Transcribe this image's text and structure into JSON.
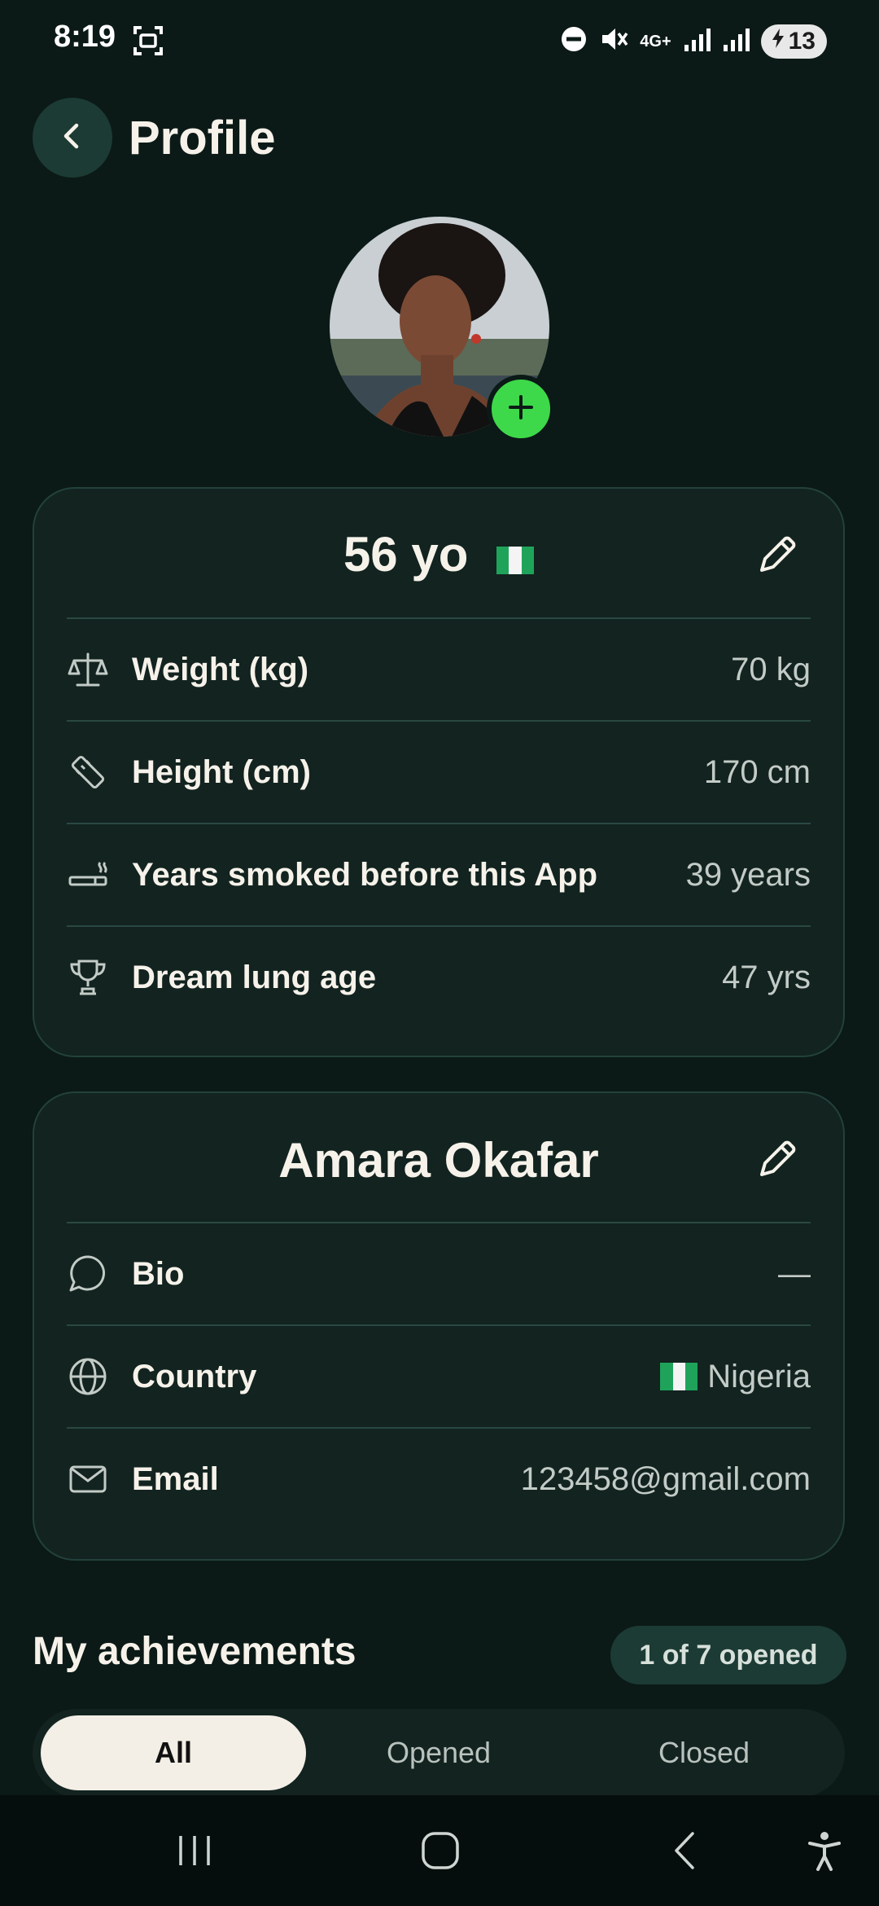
{
  "status_bar": {
    "time": "8:19",
    "network": "4G+",
    "battery": "13"
  },
  "header": {
    "title": "Profile"
  },
  "stats_card": {
    "title": "56 yo",
    "rows": [
      {
        "label": "Weight (kg)",
        "value": "70 kg",
        "icon": "scale-icon"
      },
      {
        "label": "Height (cm)",
        "value": "170 cm",
        "icon": "ruler-icon"
      },
      {
        "label": "Years smoked before this App",
        "value": "39 years",
        "icon": "cigarette-icon"
      },
      {
        "label": "Dream lung age",
        "value": "47 yrs",
        "icon": "trophy-icon"
      }
    ]
  },
  "info_card": {
    "name": "Amara Okafar",
    "rows": [
      {
        "label": "Bio",
        "value": "—",
        "icon": "chat-bubble-icon"
      },
      {
        "label": "Country",
        "value": "Nigeria",
        "icon": "globe-icon"
      },
      {
        "label": "Email",
        "value": "123458@gmail.com",
        "icon": "mail-icon"
      }
    ]
  },
  "achievements": {
    "title": "My achievements",
    "badge": "1 of 7 opened",
    "tabs": [
      "All",
      "Opened",
      "Closed"
    ],
    "active_tab": "All"
  },
  "colors": {
    "background": "#0b1a17",
    "card": "#122320",
    "accent_green": "#3ed94a",
    "flag_green": "#1fa35a"
  }
}
